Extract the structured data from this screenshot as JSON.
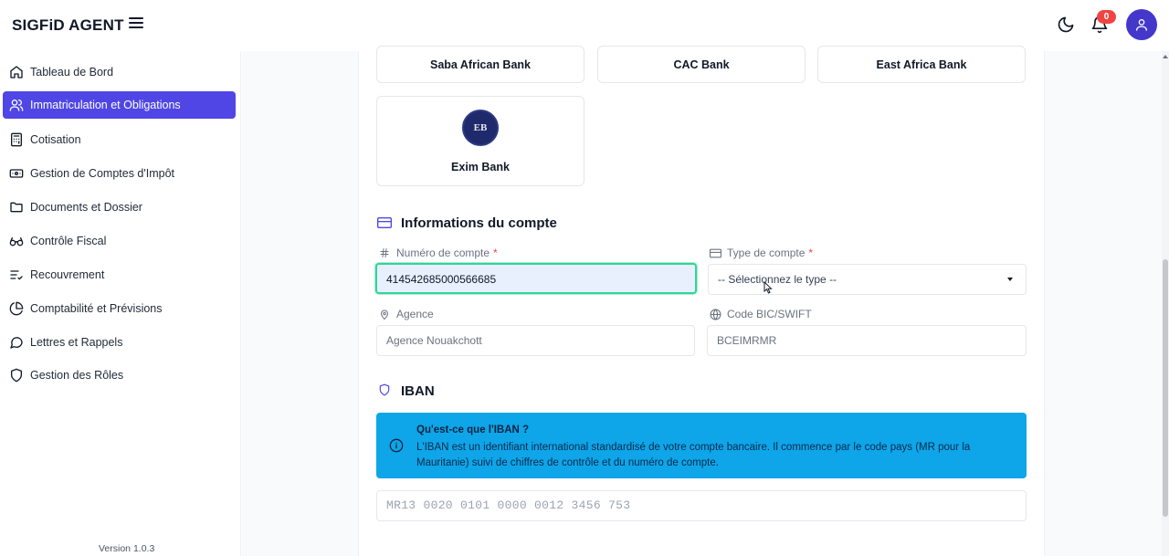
{
  "header": {
    "brand": "SIGFiD AGENT",
    "notification_count": "0",
    "icons": [
      "menu-icon",
      "moon-icon",
      "bell-icon",
      "user-icon"
    ]
  },
  "sidebar": {
    "items": [
      {
        "label": "Tableau de Bord",
        "icon": "home-icon",
        "active": false
      },
      {
        "label": "Immatriculation et Obligations",
        "icon": "users-icon",
        "active": true
      },
      {
        "label": "Cotisation",
        "icon": "calculator-icon",
        "active": false
      },
      {
        "label": "Gestion de Comptes d'Impôt",
        "icon": "banknote-icon",
        "active": false
      },
      {
        "label": "Documents et Dossier",
        "icon": "folder-icon",
        "active": false
      },
      {
        "label": "Contrôle Fiscal",
        "icon": "glasses-icon",
        "active": false
      },
      {
        "label": "Recouvrement",
        "icon": "list-check-icon",
        "active": false
      },
      {
        "label": "Comptabilité et Prévisions",
        "icon": "pie-chart-icon",
        "active": false
      },
      {
        "label": "Lettres et Rappels",
        "icon": "message-icon",
        "active": false
      },
      {
        "label": "Gestion des Rôles",
        "icon": "shield-icon",
        "active": false
      }
    ],
    "version": "Version 1.0.3"
  },
  "banks": {
    "row1": [
      "Saba African Bank",
      "CAC Bank",
      "East Africa Bank"
    ],
    "exim": {
      "name": "Exim Bank",
      "logo_text": "EB"
    }
  },
  "account": {
    "section_title": "Informations du compte",
    "numero_label": "Numéro de compte",
    "numero_value": "414542685000566685",
    "type_label": "Type de compte",
    "type_value": "-- Sélectionnez le type --",
    "agence_label": "Agence",
    "agence_placeholder": "Agence Nouakchott",
    "bic_label": "Code BIC/SWIFT",
    "bic_placeholder": "BCEIMRMR",
    "required_mark": "*"
  },
  "iban": {
    "section_title": "IBAN",
    "info_title": "Qu'est-ce que l'IBAN ?",
    "info_text": "L'IBAN est un identifiant international standardisé de votre compte bancaire. Il commence par le code pays (MR pour la Mauritanie) suivi de chiffres de contrôle et du numéro de compte.",
    "placeholder": "MR13 0020 0101 0000 0012 3456 753"
  },
  "colors": {
    "accent": "#4f46e5",
    "info_bg": "#0ea5e9",
    "focus_border": "#34d399",
    "badge": "#ef4444"
  }
}
